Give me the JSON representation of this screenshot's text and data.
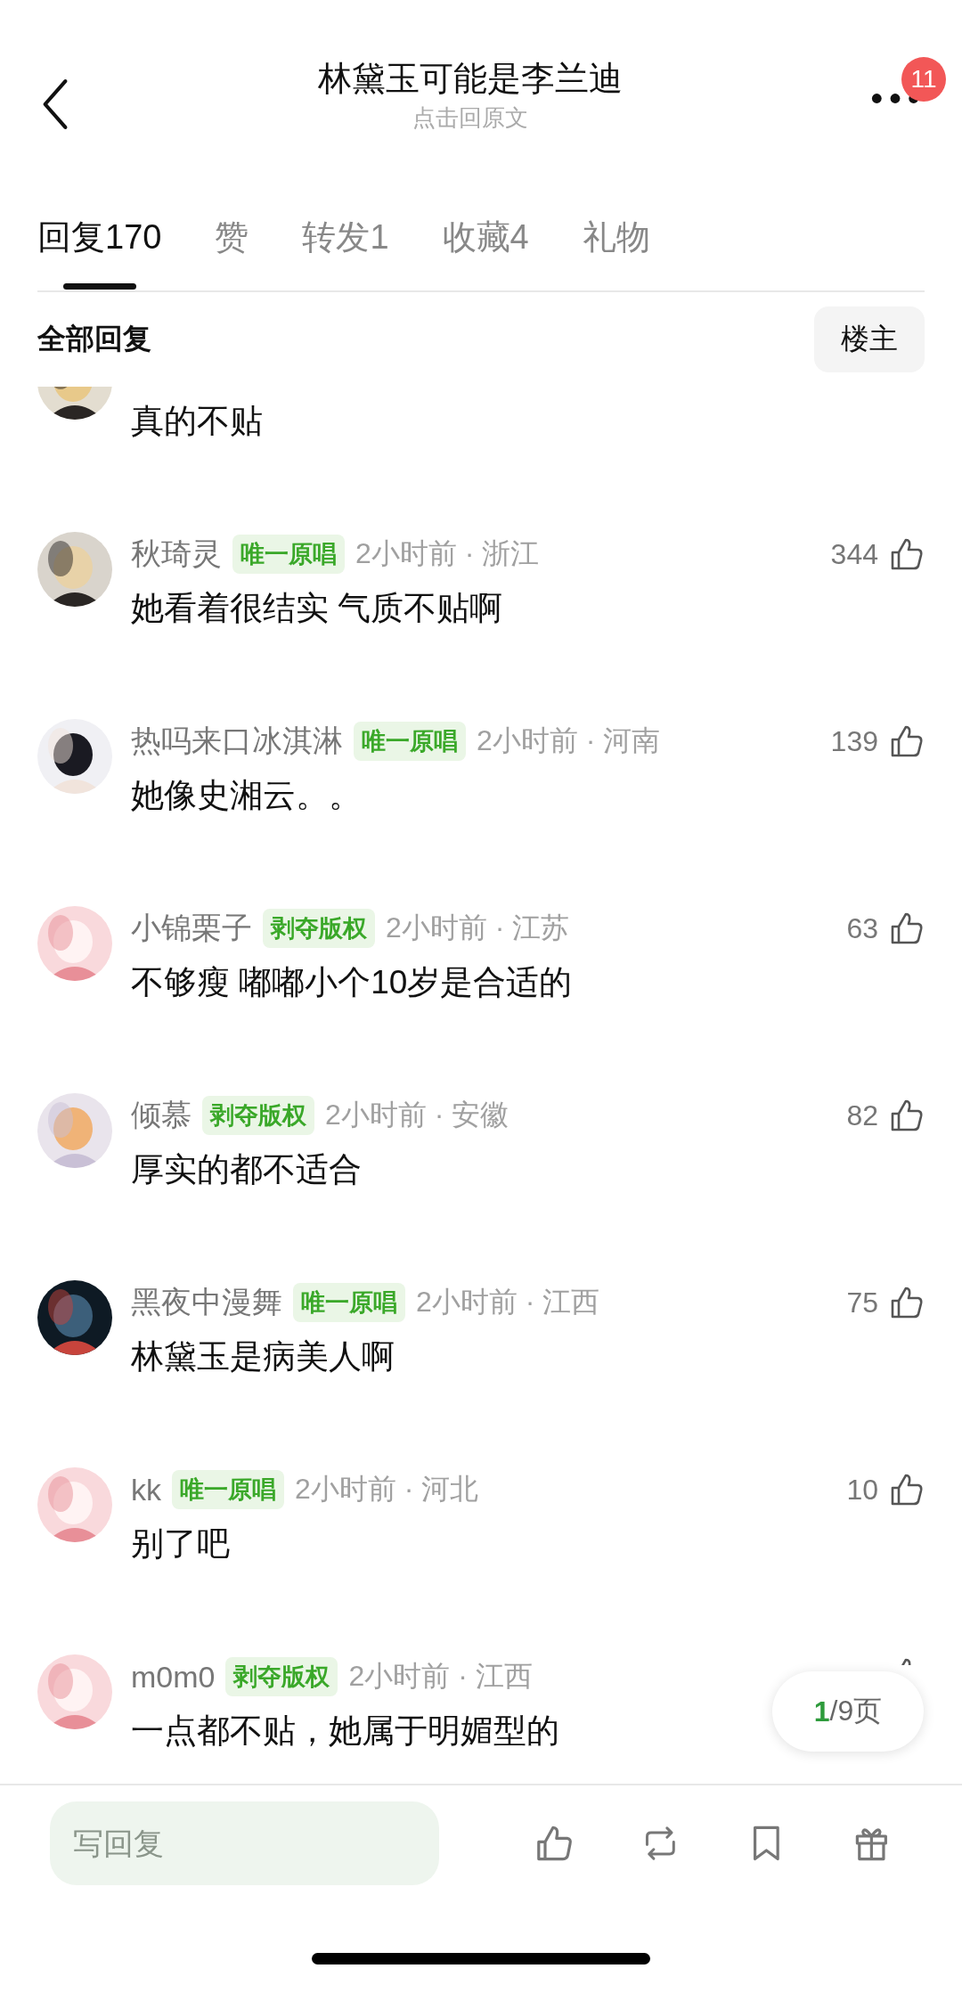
{
  "header": {
    "title": "林黛玉可能是李兰迪",
    "subtitle": "点击回原文",
    "notification_count": "11"
  },
  "tabs": [
    {
      "label": "回复",
      "count": "170",
      "selected": true
    },
    {
      "label": "赞",
      "selected": false
    },
    {
      "label": "转发",
      "count": "1",
      "selected": false
    },
    {
      "label": "收藏",
      "count": "4",
      "selected": false
    },
    {
      "label": "礼物",
      "selected": false
    }
  ],
  "section": {
    "title": "全部回复",
    "filter_button": "楼主"
  },
  "comments": [
    {
      "partial": true,
      "text": "真的不贴"
    },
    {
      "partial": false,
      "name": "秋琦灵",
      "badge": "唯一原唱",
      "meta": "2小时前 · 浙江",
      "likes": "344",
      "text": "她看着很结实 气质不贴啊"
    },
    {
      "partial": false,
      "name": "热吗来口冰淇淋",
      "badge": "唯一原唱",
      "meta": "2小时前 · 河南",
      "likes": "139",
      "text": "她像史湘云。。"
    },
    {
      "partial": false,
      "name": "小锦栗子",
      "badge": "剥夺版权",
      "meta": "2小时前 · 江苏",
      "likes": "63",
      "text": "不够瘦 嘟嘟小个10岁是合适的"
    },
    {
      "partial": false,
      "name": "倾慕",
      "badge": "剥夺版权",
      "meta": "2小时前 · 安徽",
      "likes": "82",
      "text": "厚实的都不适合"
    },
    {
      "partial": false,
      "name": "黑夜中漫舞",
      "badge": "唯一原唱",
      "meta": "2小时前 · 江西",
      "likes": "75",
      "text": "林黛玉是病美人啊"
    },
    {
      "partial": false,
      "name": "kk",
      "badge": "唯一原唱",
      "meta": "2小时前 · 河北",
      "likes": "10",
      "text": "别了吧"
    },
    {
      "partial": false,
      "name": "m0m0",
      "badge": "剥夺版权",
      "meta": "2小时前 · 江西",
      "text": "一点都不贴，她属于明媚型的"
    }
  ],
  "page_indicator": {
    "current": "1",
    "rest": "/9页"
  },
  "reply_bar": {
    "placeholder": "写回复"
  }
}
